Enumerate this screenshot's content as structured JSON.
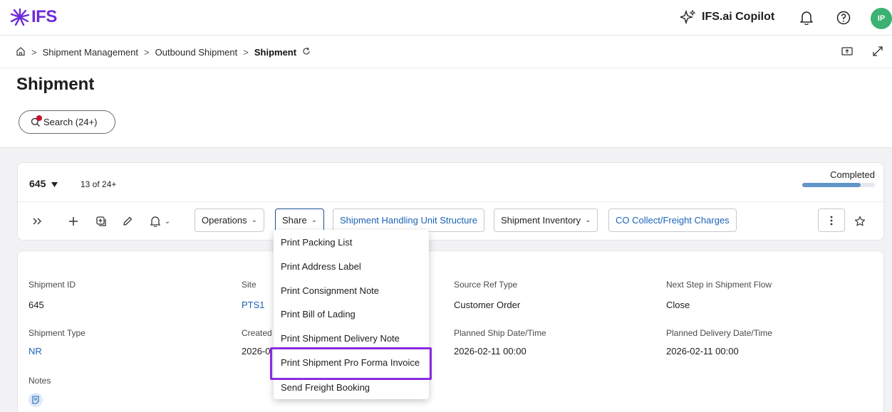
{
  "colors": {
    "brand": "#6e2bd9",
    "link": "#1c63b7",
    "avatar": "#3bb273",
    "status_fill": "#5f95c9",
    "highlight": "#8a2be2",
    "alert_dot": "#c8102e"
  },
  "topbar": {
    "logo_text": "IFS",
    "copilot_label": "IFS.ai Copilot",
    "icons": [
      "sparkle-icon",
      "bell-icon",
      "help-icon"
    ],
    "avatar_initials": "IP"
  },
  "breadcrumb": {
    "items": [
      "Shipment Management",
      "Outbound Shipment",
      "Shipment"
    ],
    "separator": ">",
    "icons": [
      "home-icon",
      "refresh-icon",
      "share-screen-icon",
      "expand-icon"
    ]
  },
  "page": {
    "title": "Shipment",
    "search_label": "Search (24+)"
  },
  "record": {
    "id": "645",
    "count": "13 of 24+",
    "status": "Completed",
    "progress": 0.8
  },
  "toolbar": {
    "icons": [
      "expand-panel-icon",
      "add-icon",
      "duplicate-icon",
      "edit-icon",
      "notification-icon"
    ],
    "buttons": [
      "Operations",
      "Share",
      "Shipment Handling Unit Structure",
      "Shipment Inventory",
      "CO Collect/Freight Charges"
    ]
  },
  "fields": {
    "shipment_id": {
      "label": "Shipment ID",
      "value": "645"
    },
    "site": {
      "label": "Site",
      "value": "PTS1"
    },
    "source_ref_type": {
      "label": "Source Ref Type",
      "value": "Customer Order"
    },
    "next_step": {
      "label": "Next Step in Shipment Flow",
      "value": "Close"
    },
    "shipment_type": {
      "label": "Shipment Type",
      "value": "NR"
    },
    "created": {
      "label": "Created",
      "value": "2026-0"
    },
    "planned_ship": {
      "label": "Planned Ship Date/Time",
      "value": "2026-02-11 00:00"
    },
    "planned_delivery": {
      "label": "Planned Delivery Date/Time",
      "value": "2026-02-11 00:00"
    },
    "notes": {
      "label": "Notes"
    }
  },
  "share_menu": {
    "items": [
      "Print Packing List",
      "Print Address Label",
      "Print Consignment Note",
      "Print Bill of Lading",
      "Print Shipment Delivery Note",
      "Print Shipment Pro Forma Invoice",
      "Send Freight Booking"
    ],
    "highlighted": "Print Shipment Pro Forma Invoice"
  }
}
